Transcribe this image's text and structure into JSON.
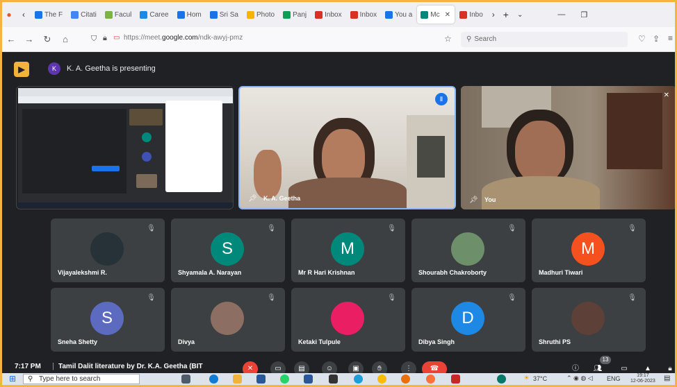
{
  "browser": {
    "tabs": [
      {
        "label": "The F",
        "color": "#1a73e8"
      },
      {
        "label": "Citati",
        "color": "#4285f4"
      },
      {
        "label": "Facul",
        "color": "#7cb342"
      },
      {
        "label": "Caree",
        "color": "#1e88e5"
      },
      {
        "label": "Hom",
        "color": "#1a73e8"
      },
      {
        "label": "Sri Sa",
        "color": "#1a73e8"
      },
      {
        "label": "Photo",
        "color": "#f4b400"
      },
      {
        "label": "Panj",
        "color": "#0f9d58"
      },
      {
        "label": "Inbox",
        "color": "#d93025"
      },
      {
        "label": "Inbox",
        "color": "#d93025"
      },
      {
        "label": "You a",
        "color": "#1a73e8"
      },
      {
        "label": "Mc",
        "color": "#00897b"
      },
      {
        "label": "Inbo",
        "color": "#d93025"
      }
    ],
    "url_prefix": "https://meet.",
    "url_domain": "google.com",
    "url_path": "/ndk-awyj-pmz",
    "search_placeholder": "Search"
  },
  "meet": {
    "presenter_initial": "K",
    "presenting_text": "K. A. Geetha is presenting",
    "speaker_name": "K. A. Geetha",
    "self_name": "You",
    "participants": [
      {
        "name": "Vijayalekshmi R.",
        "initial": "",
        "color": "#263238"
      },
      {
        "name": "Shyamala A. Narayan",
        "initial": "S",
        "color": "#00897b"
      },
      {
        "name": "Mr R Hari Krishnan",
        "initial": "M",
        "color": "#00897b"
      },
      {
        "name": "Shourabh Chakroborty",
        "initial": "",
        "color": "#6d8f6a"
      },
      {
        "name": "Madhuri Tiwari",
        "initial": "M",
        "color": "#f4511e"
      },
      {
        "name": "Sneha Shetty",
        "initial": "S",
        "color": "#5c6bc0"
      },
      {
        "name": "Divya",
        "initial": "",
        "color": "#8d6e63"
      },
      {
        "name": "Ketaki Tulpule",
        "initial": "",
        "color": "#e91e63"
      },
      {
        "name": "Dibya Singh",
        "initial": "D",
        "color": "#1e88e5"
      },
      {
        "name": "Shruthi PS",
        "initial": "",
        "color": "#5d4037"
      }
    ],
    "time": "7:17 PM",
    "meeting_title": "Tamil Dalit literature by Dr. K.A. Geetha (BIT",
    "participant_count": "13"
  },
  "taskbar": {
    "search_placeholder": "Type here to search",
    "temperature": "37°C",
    "language": "ENG",
    "clock_time": "19:17",
    "clock_date": "12-06-2023"
  }
}
